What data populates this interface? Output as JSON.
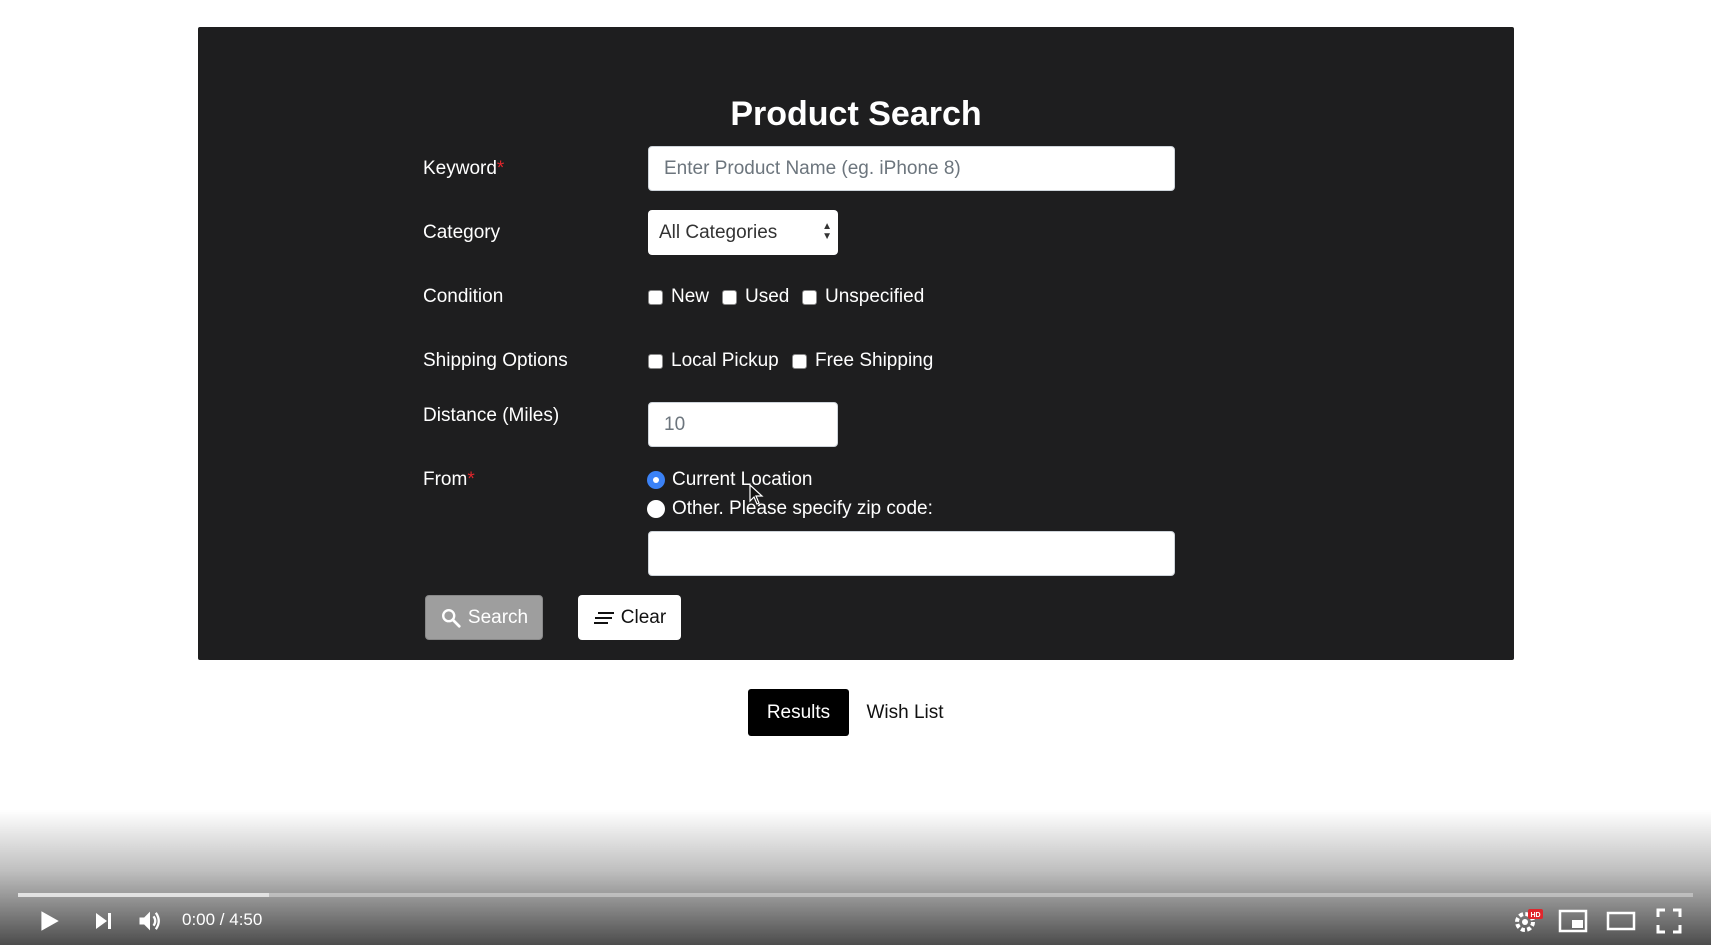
{
  "form": {
    "title": "Product Search",
    "keyword": {
      "label": "Keyword",
      "required_mark": "*",
      "placeholder": "Enter Product Name (eg. iPhone 8)"
    },
    "category": {
      "label": "Category",
      "selected": "All Categories"
    },
    "condition": {
      "label": "Condition",
      "options": [
        "New",
        "Used",
        "Unspecified"
      ]
    },
    "shipping": {
      "label": "Shipping Options",
      "options": [
        "Local Pickup",
        "Free Shipping"
      ]
    },
    "distance": {
      "label": "Distance (Miles)",
      "value": "10"
    },
    "from": {
      "label": "From",
      "required_mark": "*",
      "option_current": "Current Location",
      "option_other": "Other. Please specify zip code:",
      "zip_value": ""
    },
    "buttons": {
      "search": "Search",
      "clear": "Clear"
    }
  },
  "tabs": {
    "results": "Results",
    "wish_list": "Wish List"
  },
  "player": {
    "time": "0:00 / 4:50",
    "progress_fraction": 0.15,
    "icons": [
      "play-icon",
      "next-icon",
      "volume-icon",
      "settings-hd-icon",
      "miniplayer-icon",
      "theater-icon",
      "fullscreen-icon"
    ]
  }
}
